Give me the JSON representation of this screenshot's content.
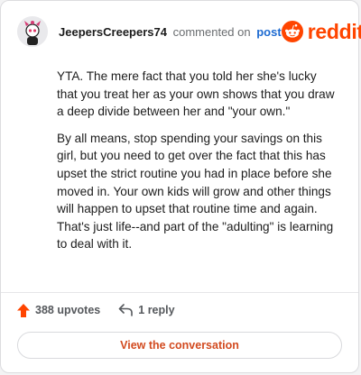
{
  "header": {
    "username": "JeepersCreepers74",
    "action_text": "commented on",
    "post_link": "post",
    "logo_text": "reddit",
    "avatar_icon": "snoo-avatar-icon",
    "logo_icon": "reddit-snoo-icon"
  },
  "comment": {
    "paragraphs": [
      "YTA. The mere fact that you told her she's lucky that you treat her as your own shows that you draw a deep divide between her and \"your own.\"",
      "By all means, stop spending your savings on this girl, but you need to get over the fact that this has upset the strict routine you had in place before she moved in. Your own kids will grow and other things will happen to upset that routine time and again. That's just life--and part of the \"adulting\" is learning to deal with it."
    ]
  },
  "actions": {
    "upvotes_label": "388 upvotes",
    "replies_label": "1 reply",
    "upvote_icon": "upvote-arrow-icon",
    "reply_icon": "reply-arrow-icon"
  },
  "button": {
    "view_label": "View the conversation"
  },
  "colors": {
    "brand": "#ff4500",
    "link": "#1e6bd1",
    "button_text": "#d24a1f"
  }
}
